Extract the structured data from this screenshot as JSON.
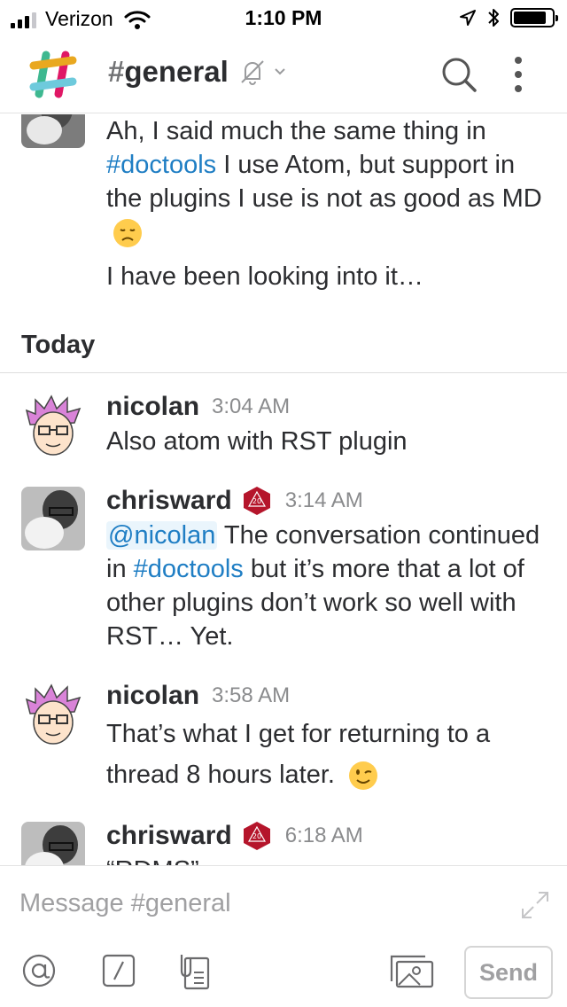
{
  "status_bar": {
    "carrier": "Verizon",
    "time": "1:10 PM",
    "signal_bars": 4,
    "signal_strength": 3,
    "battery_level": 0.85
  },
  "header": {
    "hash": "#",
    "channel_name": "general",
    "icons": [
      "slack-logo-icon",
      "muted-bell-icon",
      "chevron-down-icon",
      "search-icon",
      "more-vertical-icon"
    ]
  },
  "messages_top": {
    "text_1_pre": "Ah, I said much the same thing in ",
    "text_1_link": "#doctools",
    "text_1_post": " I use Atom, but support in the plugins I use is not as good as MD",
    "emoji_1": "disappointed-emoji",
    "text_2": "I have been looking into it…"
  },
  "divider": {
    "label": "Today"
  },
  "messages": [
    {
      "author": "nicolan",
      "time": "3:04 AM",
      "text": "Also atom with RST plugin"
    },
    {
      "author": "chrisward",
      "badge": "d20-icon",
      "time": "3:14 AM",
      "mention": "@nicolan",
      "text_pre": " The conversation continued in ",
      "link": "#doctools",
      "text_post": " but it’s more that a lot of other plugins don’t work so well with RST… Yet."
    },
    {
      "author": "nicolan",
      "time": "3:58 AM",
      "text": "That’s what I get for returning to a thread 8 hours later.",
      "emoji": "wink-emoji"
    },
    {
      "author": "chrisward",
      "badge": "d20-icon",
      "time": "6:18 AM",
      "text": "“RDMS”"
    }
  ],
  "composer": {
    "placeholder": "Message #general",
    "send_label": "Send",
    "tools": [
      "at-mention-icon",
      "slash-command-icon",
      "file-icon",
      "photo-icon"
    ]
  },
  "colors": {
    "link": "#1f7ec4",
    "mention_bg": "#eaf5fc",
    "timestamp": "#8a8b8d",
    "text": "#2c2d30"
  }
}
